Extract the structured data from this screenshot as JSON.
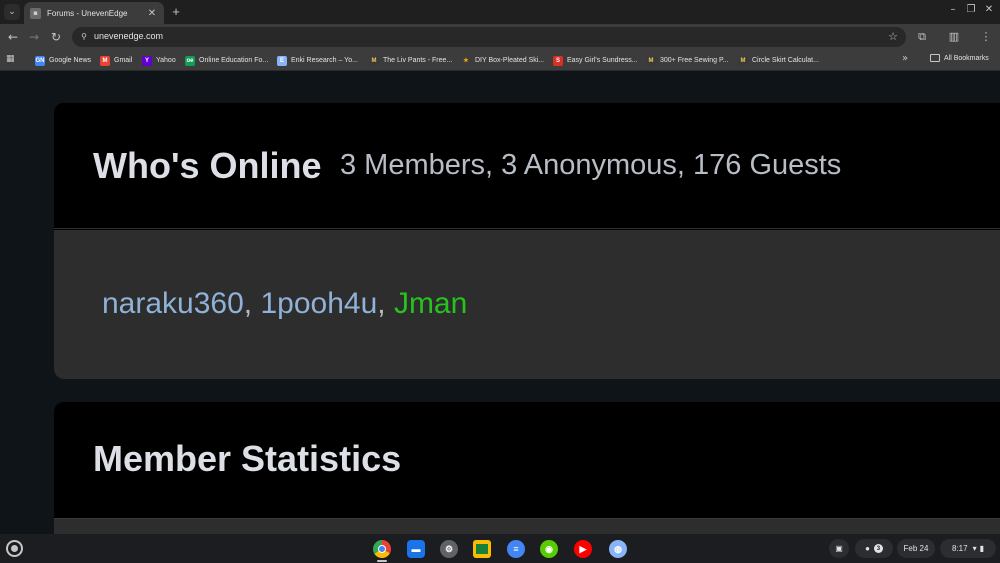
{
  "browser": {
    "tab": {
      "title": "Forums - UnevenEdge"
    },
    "url": "unevenedge.com",
    "bookmarks": [
      {
        "label": "Google News",
        "icon": "google-news-icon",
        "color": "#4285f4",
        "glyph": "GN"
      },
      {
        "label": "Gmail",
        "icon": "gmail-icon",
        "color": "#ea4335",
        "glyph": "M"
      },
      {
        "label": "Yahoo",
        "icon": "yahoo-icon",
        "color": "#6001d2",
        "glyph": "Y"
      },
      {
        "label": "Online Education Fo...",
        "icon": "education-icon",
        "color": "#0f9d58",
        "glyph": "oe"
      },
      {
        "label": "Enki Research – Yo...",
        "icon": "enki-icon",
        "color": "#8ab4f8",
        "glyph": "E"
      },
      {
        "label": "The Liv Pants - Free...",
        "icon": "mood-fabrics-icon",
        "color": "#3a3a3a",
        "glyph": "M"
      },
      {
        "label": "DIY Box-Pleated Ski...",
        "icon": "diy-icon",
        "color": "#f9ab00",
        "glyph": "★"
      },
      {
        "label": "Easy Girl's Sundress...",
        "icon": "sewing-icon",
        "color": "#d93025",
        "glyph": "S"
      },
      {
        "label": "300+ Free Sewing P...",
        "icon": "mood-fabrics-icon-2",
        "color": "#3a3a3a",
        "glyph": "M"
      },
      {
        "label": "Circle Skirt Calculat...",
        "icon": "mood-fabrics-icon-3",
        "color": "#3a3a3a",
        "glyph": "M"
      }
    ],
    "all_bookmarks": "All Bookmarks"
  },
  "page": {
    "whos_online": {
      "title": "Who's Online",
      "summary": "3 Members, 3 Anonymous, 176 Guests",
      "members": [
        "naraku360",
        "1pooh4u",
        "Jman"
      ],
      "separator": ", "
    },
    "member_statistics": {
      "title": "Member Statistics"
    }
  },
  "shelf": {
    "apps": [
      {
        "name": "chrome-icon",
        "color": "#4285f4",
        "glyph": "●"
      },
      {
        "name": "files-icon",
        "color": "#1a73e8",
        "glyph": "▮"
      },
      {
        "name": "settings-icon",
        "color": "#5f6368",
        "glyph": "⚙"
      },
      {
        "name": "classroom-icon",
        "color": "#188038",
        "glyph": "▣"
      },
      {
        "name": "docs-icon",
        "color": "#4285f4",
        "glyph": "≡"
      },
      {
        "name": "duolingo-icon",
        "color": "#58cc02",
        "glyph": "◉"
      },
      {
        "name": "youtube-icon",
        "color": "#ff0000",
        "glyph": "▶"
      },
      {
        "name": "web-app-icon",
        "color": "#8ab4f8",
        "glyph": "◍"
      }
    ],
    "notification_count": "3",
    "date": "Feb 24",
    "time": "8:17"
  }
}
